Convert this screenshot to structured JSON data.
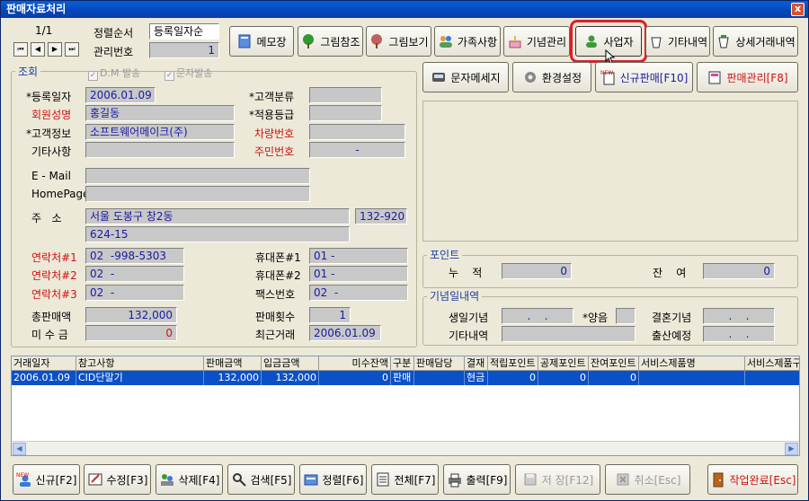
{
  "window": {
    "title": "판매자료처리",
    "close": "x"
  },
  "nav": {
    "counter": "1/1",
    "first": "⏮",
    "prev": "◀",
    "next": "▶",
    "last": "⏭"
  },
  "sort": {
    "label": "정렬순서",
    "value": "등록일자순"
  },
  "mgmt": {
    "label": "관리번호",
    "value": "1"
  },
  "topButtons": {
    "memo": "메모장",
    "imgref": "그림참조",
    "imgview": "그림보기",
    "family": "가족사항",
    "anniv": "기념관리",
    "business": "사업자",
    "etc": "기타내역",
    "detail": "상세거래내역"
  },
  "secondButtons": {
    "sms": "문자메세지",
    "env": "환경설정",
    "newsale": "신규판매[F10]",
    "salemgmt": "판매관리[F8]"
  },
  "newBadge": "NEW",
  "query": {
    "title": "조회",
    "dm": "D.M 발송",
    "smsSend": "문자발송",
    "regDateLabel": "*등록일자",
    "regDate": "2006.01.09",
    "custTypeLabel": "*고객분류",
    "custType": "",
    "memberNameLabel": "회원성명",
    "memberName": "홍길동",
    "gradeLabel": "*적용등급",
    "grade": "",
    "custInfoLabel": "*고객정보",
    "custInfo": "소프트웨어메이크(주)",
    "carNoLabel": "차량번호",
    "carNo": "",
    "etcLabel": "기타사항",
    "etc": "",
    "ssnLabel": "주민번호",
    "ssn": "-",
    "emailLabel": "E - Mail",
    "email": "",
    "homepageLabel": "HomePage",
    "homepage": "",
    "addrLabel": "주   소",
    "addr1": "서울 도봉구 창2동",
    "zip": "132-920",
    "addr2": "624-15",
    "tel1Label": "연락처#1",
    "tel1": "02  -998-5303",
    "tel2Label": "연락처#2",
    "tel2": "02  -",
    "tel3Label": "연락처#3",
    "tel3": "02  -",
    "mob1Label": "휴대폰#1",
    "mob1": "01 -",
    "mob2Label": "휴대폰#2",
    "mob2": "01 -",
    "faxLabel": "팩스번호",
    "fax": "02  -",
    "totalLabel": "총판매액",
    "total": "132,000",
    "unpaidLabel": "미 수 금",
    "unpaid": "0",
    "countLabel": "판매횟수",
    "count": "1",
    "lastLabel": "최근거래",
    "last": "2006.01.09"
  },
  "points": {
    "title": "포인트",
    "accLabel": "누    적",
    "acc": "0",
    "remainLabel": "잔    여",
    "remain": "0"
  },
  "anniv": {
    "title": "기념일내역",
    "birthLabel": "생일기념",
    "birth": ".    .",
    "lunarLabel": "*양음",
    "lunar": "",
    "weddingLabel": "결혼기념",
    "wedding": ".    .",
    "etcLabel": "기타내역",
    "etc": "",
    "dueLabel": "출산예정",
    "due": ".    ."
  },
  "grid": {
    "columns": [
      "거래일자",
      "참고사항",
      "판매금액",
      "입금금액",
      "미수잔액",
      "구분",
      "판매담당",
      "결재",
      "적립포인트",
      "공제포인트",
      "잔여포인트",
      "서비스제품명",
      "서비스제품구"
    ],
    "rows": [
      [
        "2006.01.09",
        "CID단말기",
        "132,000",
        "132,000",
        "0",
        "판매",
        "",
        "현금",
        "0",
        "0",
        "0",
        "",
        ""
      ]
    ]
  },
  "bottomButtons": {
    "new": "신규[F2]",
    "edit": "수정[F3]",
    "del": "삭제[F4]",
    "search": "검색[F5]",
    "sort": "정렬[F6]",
    "all": "전체[F7]",
    "print": "출력[F9]",
    "save": "저 장[F12]",
    "cancel": "취소[Esc]",
    "done": "작업완료[Esc]"
  },
  "colors": {
    "highlight": "#d01010",
    "fieldText": "#1a1aa0",
    "selectedRow": "#0a50c8"
  }
}
